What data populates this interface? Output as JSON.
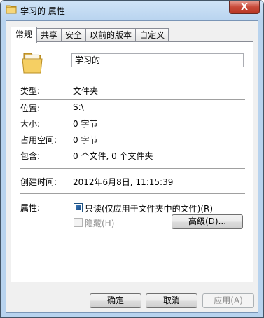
{
  "window": {
    "title": "学习的 属性",
    "close_glyph": "X"
  },
  "tabs": [
    {
      "label": "常规",
      "active": true
    },
    {
      "label": "共享",
      "active": false
    },
    {
      "label": "安全",
      "active": false
    },
    {
      "label": "以前的版本",
      "active": false
    },
    {
      "label": "自定义",
      "active": false
    }
  ],
  "general": {
    "folder_name": "学习的",
    "type_label": "类型:",
    "type_value": "文件夹",
    "location_label": "位置:",
    "location_value": "S:\\",
    "size_label": "大小:",
    "size_value": "0 字节",
    "size_on_disk_label": "占用空间:",
    "size_on_disk_value": "0 字节",
    "contains_label": "包含:",
    "contains_value": "0 个文件, 0 个文件夹",
    "created_label": "创建时间:",
    "created_value": "2012年6月8日, 11:15:39",
    "attributes_label": "属性:",
    "readonly_label": "只读(仅应用于文件夹中的文件)(R)",
    "hidden_label": "隐藏(H)",
    "advanced_label": "高级(D)..."
  },
  "footer": {
    "ok_label": "确定",
    "cancel_label": "取消",
    "apply_label": "应用(A)"
  },
  "icons": {
    "title": "folder-icon",
    "folder": "folder-icon"
  }
}
